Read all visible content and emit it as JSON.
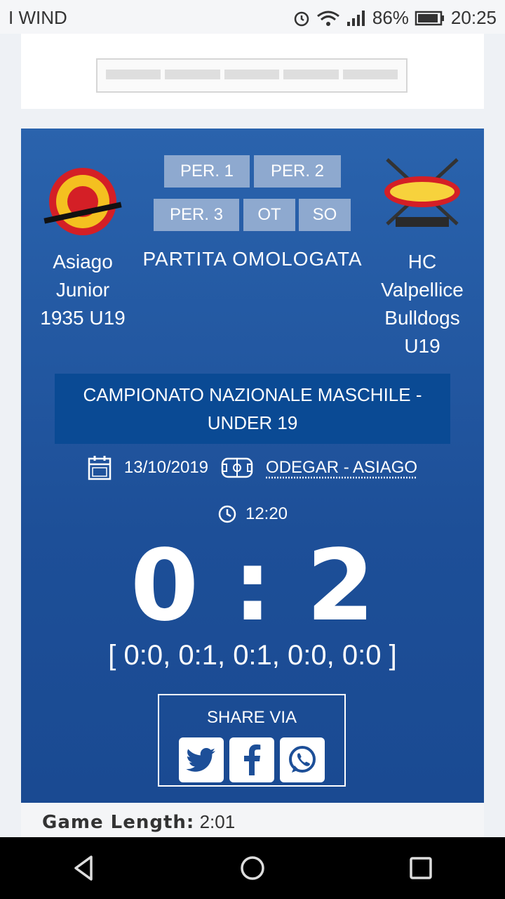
{
  "status_bar": {
    "carrier": "I WIND",
    "battery": "86%",
    "time": "20:25"
  },
  "match": {
    "home": {
      "name_lines": [
        "Asiago",
        "Junior",
        "1935 U19"
      ]
    },
    "away": {
      "name_lines": [
        "HC",
        "Valpellice",
        "Bulldogs",
        "U19"
      ]
    },
    "periods_tabs": [
      "PER. 1",
      "PER. 2",
      "PER. 3",
      "OT",
      "SO"
    ],
    "status": "PARTITA OMOLOGATA",
    "league_lines": [
      "CAMPIONATO NAZIONALE MASCHILE -",
      "UNDER 19"
    ],
    "date": "13/10/2019",
    "venue": "ODEGAR - ASIAGO",
    "time": "12:20",
    "score": "0 : 2",
    "period_scores": "[  0:0, 0:1, 0:1, 0:0, 0:0 ]",
    "share_label": "SHARE VIA",
    "game_length_label": "Game Length:",
    "game_length_value": "2:01"
  },
  "icons": {
    "calendar": "calendar-icon",
    "rink": "rink-icon",
    "clock": "clock-icon",
    "twitter": "twitter-icon",
    "facebook": "facebook-icon",
    "whatsapp": "whatsapp-icon"
  },
  "colors": {
    "card_blue": "#2a63ad",
    "league_blue": "#0a4a94",
    "tab_grey_blue": "#8ea9cf"
  }
}
